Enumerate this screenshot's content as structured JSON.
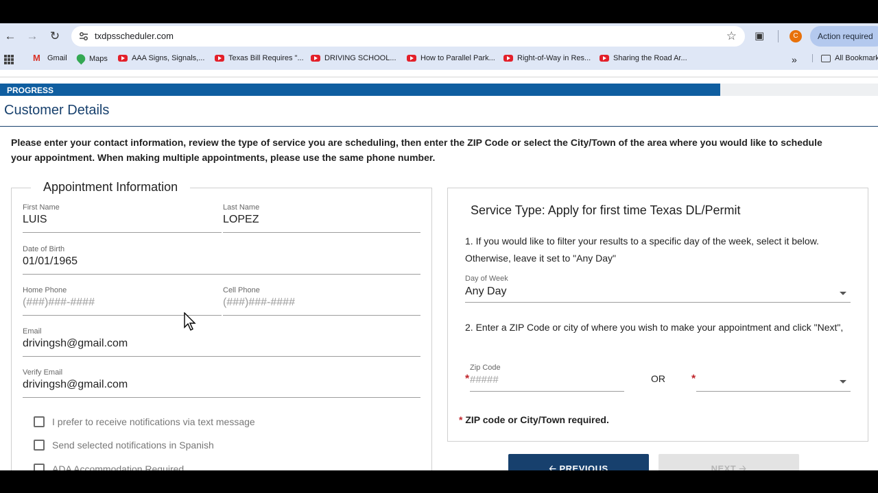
{
  "browser": {
    "url": "txdpsscheduler.com",
    "action_button": "Action required",
    "profile_initial": "C",
    "bookmarks": [
      {
        "label": "Gmail",
        "icon": "gmail-icon"
      },
      {
        "label": "Maps",
        "icon": "maps-icon"
      },
      {
        "label": "AAA Signs, Signals,...",
        "icon": "youtube-icon"
      },
      {
        "label": "Texas Bill Requires \"...",
        "icon": "youtube-icon"
      },
      {
        "label": "DRIVING SCHOOL...",
        "icon": "youtube-icon"
      },
      {
        "label": "How to Parallel Park...",
        "icon": "youtube-icon"
      },
      {
        "label": "Right-of-Way in Res...",
        "icon": "youtube-icon"
      },
      {
        "label": "Sharing the Road Ar...",
        "icon": "youtube-icon"
      }
    ],
    "all_bookmarks": "All Bookmarks"
  },
  "progress": {
    "label": "PROGRESS",
    "fraction": 0.82
  },
  "page": {
    "title": "Customer Details",
    "intro": "Please enter your contact information, review the type of service you are scheduling, then enter the ZIP Code or select the City/Town of the area where you would like to schedule your appointment. When making multiple appointments, please use the same phone number."
  },
  "appointment": {
    "legend": "Appointment Information",
    "first_name": {
      "label": "First Name",
      "value": "LUIS"
    },
    "last_name": {
      "label": "Last Name",
      "value": "LOPEZ"
    },
    "dob": {
      "label": "Date of Birth",
      "value": "01/01/1965"
    },
    "home_phone": {
      "label": "Home Phone",
      "placeholder": "(###)###-####"
    },
    "cell_phone": {
      "label": "Cell Phone",
      "placeholder": "(###)###-####"
    },
    "email": {
      "label": "Email",
      "value": "drivingsh@gmail.com"
    },
    "verify_email": {
      "label": "Verify Email",
      "value": "drivingsh@gmail.com"
    },
    "checkboxes": [
      "I prefer to receive notifications via text message",
      "Send selected notifications in Spanish",
      "ADA Accommodation Required"
    ]
  },
  "service": {
    "title": "Service Type: Apply for first time Texas DL/Permit",
    "step1": "1. If you would like to filter your results to a specific day of the week, select it below. Otherwise, leave it set to \"Any Day\"",
    "day_label": "Day of Week",
    "day_value": "Any Day",
    "step2": "2. Enter a ZIP Code or city of where you wish to make your appointment and click \"Next\",",
    "zip_label": "Zip Code",
    "zip_placeholder": "#####",
    "or": "OR",
    "required_mark": "*",
    "required_note": "ZIP code or City/Town required."
  },
  "buttons": {
    "previous": "PREVIOUS",
    "next": "NEXT"
  },
  "colors": {
    "brand": "#17406d",
    "progress": "#0f5ea0",
    "required": "#c0262c"
  }
}
